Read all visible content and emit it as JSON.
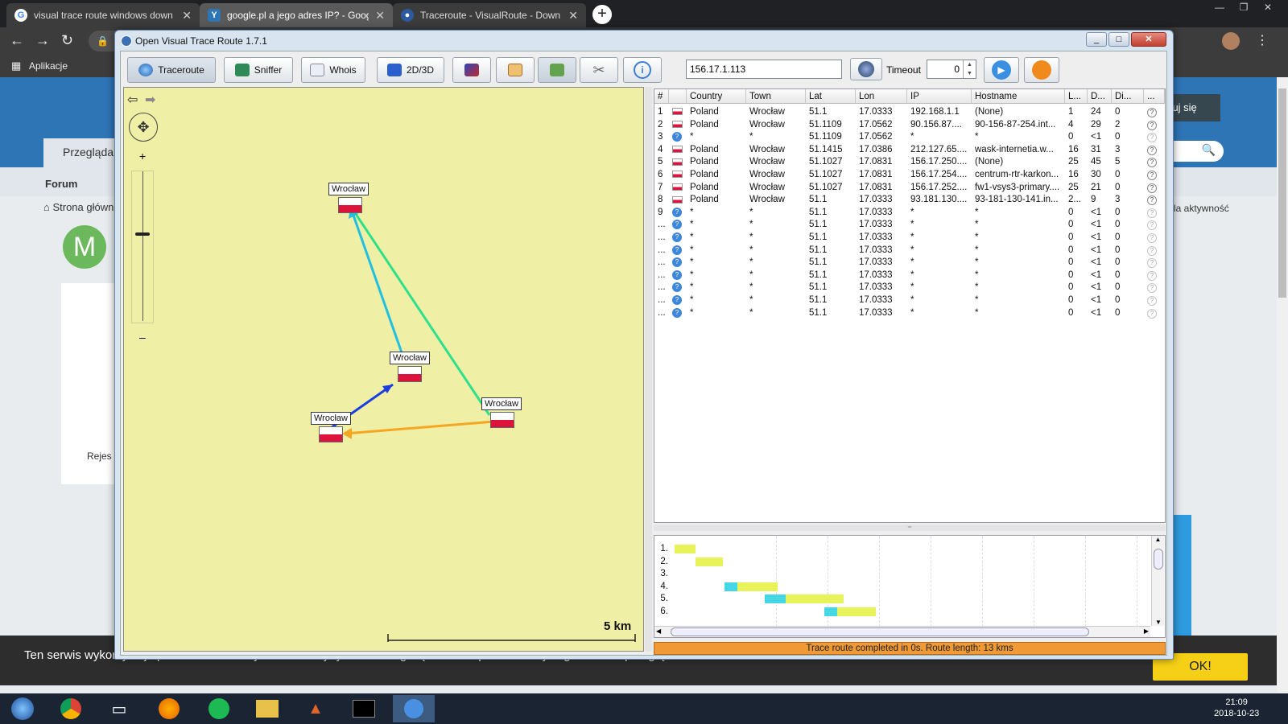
{
  "browser": {
    "tabs": [
      {
        "title": "visual trace route windows down",
        "icon": "google-icon"
      },
      {
        "title": "google.pl a jego adres IP? - Goog",
        "icon": "forum-icon"
      },
      {
        "title": "Traceroute - VisualRoute - Down",
        "icon": "visualroute-icon"
      }
    ],
    "new_tab": "+",
    "bookmarks_label": "Aplikacje"
  },
  "bg_page": {
    "nav_item": "Przegląda",
    "forum": "Forum",
    "breadcrumb": "Strona główn",
    "avatar_letter": "M",
    "register_button": "struj się",
    "activity": "la aktywność",
    "side_fragment": "Rejes"
  },
  "cookie": {
    "text": "Ten serwis wykorzystuje pliki cookies. Korzystanie z witryny oznacza zgodę na ich zapis lub odczyt wg ustawień przeglądarki.",
    "ok": "OK!"
  },
  "taskbar": {
    "time": "21:09",
    "date": "2018-10-23"
  },
  "app": {
    "title": "Open Visual Trace Route 1.7.1",
    "toolbar": {
      "traceroute": "Traceroute",
      "sniffer": "Sniffer",
      "whois": "Whois",
      "view": "2D/3D"
    },
    "ip": "156.17.1.113",
    "timeout_label": "Timeout",
    "timeout_value": "0",
    "map": {
      "labels": [
        "Wrocław",
        "Wrocław",
        "Wrocław",
        "Wrocław"
      ],
      "scale": "5 km"
    },
    "table": {
      "columns": [
        "#",
        "",
        "Country",
        "Town",
        "Lat",
        "Lon",
        "IP",
        "Hostname",
        "L...",
        "D...",
        "Di...",
        "..."
      ],
      "rows": [
        {
          "n": "1",
          "flag": "pl",
          "country": "Poland",
          "town": "Wrocław",
          "lat": "51.1",
          "lon": "17.0333",
          "ip": "192.168.1.1",
          "host": "(None)",
          "l": "1",
          "d": "24",
          "di": "0"
        },
        {
          "n": "2",
          "flag": "pl",
          "country": "Poland",
          "town": "Wrocław",
          "lat": "51.1109",
          "lon": "17.0562",
          "ip": "90.156.87....",
          "host": "90-156-87-254.int...",
          "l": "4",
          "d": "29",
          "di": "2"
        },
        {
          "n": "3",
          "flag": "unknown",
          "country": "*",
          "town": "*",
          "lat": "51.1109",
          "lon": "17.0562",
          "ip": "*",
          "host": "*",
          "l": "0",
          "d": "<1",
          "di": "0"
        },
        {
          "n": "4",
          "flag": "pl",
          "country": "Poland",
          "town": "Wrocław",
          "lat": "51.1415",
          "lon": "17.0386",
          "ip": "212.127.65....",
          "host": "wask-internetia.w...",
          "l": "16",
          "d": "31",
          "di": "3"
        },
        {
          "n": "5",
          "flag": "pl",
          "country": "Poland",
          "town": "Wrocław",
          "lat": "51.1027",
          "lon": "17.0831",
          "ip": "156.17.250....",
          "host": "(None)",
          "l": "25",
          "d": "45",
          "di": "5"
        },
        {
          "n": "6",
          "flag": "pl",
          "country": "Poland",
          "town": "Wrocław",
          "lat": "51.1027",
          "lon": "17.0831",
          "ip": "156.17.254....",
          "host": "centrum-rtr-karkon...",
          "l": "16",
          "d": "30",
          "di": "0"
        },
        {
          "n": "7",
          "flag": "pl",
          "country": "Poland",
          "town": "Wrocław",
          "lat": "51.1027",
          "lon": "17.0831",
          "ip": "156.17.252....",
          "host": "fw1-vsys3-primary....",
          "l": "25",
          "d": "21",
          "di": "0"
        },
        {
          "n": "8",
          "flag": "pl",
          "country": "Poland",
          "town": "Wrocław",
          "lat": "51.1",
          "lon": "17.0333",
          "ip": "93.181.130....",
          "host": "93-181-130-141.in...",
          "l": "2...",
          "d": "9",
          "di": "3"
        },
        {
          "n": "9",
          "flag": "unknown",
          "country": "*",
          "town": "*",
          "lat": "51.1",
          "lon": "17.0333",
          "ip": "*",
          "host": "*",
          "l": "0",
          "d": "<1",
          "di": "0"
        },
        {
          "n": "...",
          "flag": "unknown",
          "country": "*",
          "town": "*",
          "lat": "51.1",
          "lon": "17.0333",
          "ip": "*",
          "host": "*",
          "l": "0",
          "d": "<1",
          "di": "0"
        },
        {
          "n": "...",
          "flag": "unknown",
          "country": "*",
          "town": "*",
          "lat": "51.1",
          "lon": "17.0333",
          "ip": "*",
          "host": "*",
          "l": "0",
          "d": "<1",
          "di": "0"
        },
        {
          "n": "...",
          "flag": "unknown",
          "country": "*",
          "town": "*",
          "lat": "51.1",
          "lon": "17.0333",
          "ip": "*",
          "host": "*",
          "l": "0",
          "d": "<1",
          "di": "0"
        },
        {
          "n": "...",
          "flag": "unknown",
          "country": "*",
          "town": "*",
          "lat": "51.1",
          "lon": "17.0333",
          "ip": "*",
          "host": "*",
          "l": "0",
          "d": "<1",
          "di": "0"
        },
        {
          "n": "...",
          "flag": "unknown",
          "country": "*",
          "town": "*",
          "lat": "51.1",
          "lon": "17.0333",
          "ip": "*",
          "host": "*",
          "l": "0",
          "d": "<1",
          "di": "0"
        },
        {
          "n": "...",
          "flag": "unknown",
          "country": "*",
          "town": "*",
          "lat": "51.1",
          "lon": "17.0333",
          "ip": "*",
          "host": "*",
          "l": "0",
          "d": "<1",
          "di": "0"
        },
        {
          "n": "...",
          "flag": "unknown",
          "country": "*",
          "town": "*",
          "lat": "51.1",
          "lon": "17.0333",
          "ip": "*",
          "host": "*",
          "l": "0",
          "d": "<1",
          "di": "0"
        },
        {
          "n": "...",
          "flag": "unknown",
          "country": "*",
          "town": "*",
          "lat": "51.1",
          "lon": "17.0333",
          "ip": "*",
          "host": "*",
          "l": "0",
          "d": "<1",
          "di": "0"
        }
      ]
    },
    "gantt": {
      "labels": [
        "1.",
        "2.",
        "3.",
        "4.",
        "5.",
        "6."
      ]
    },
    "status": "Trace route completed in 0s. Route length: 13 kms"
  }
}
